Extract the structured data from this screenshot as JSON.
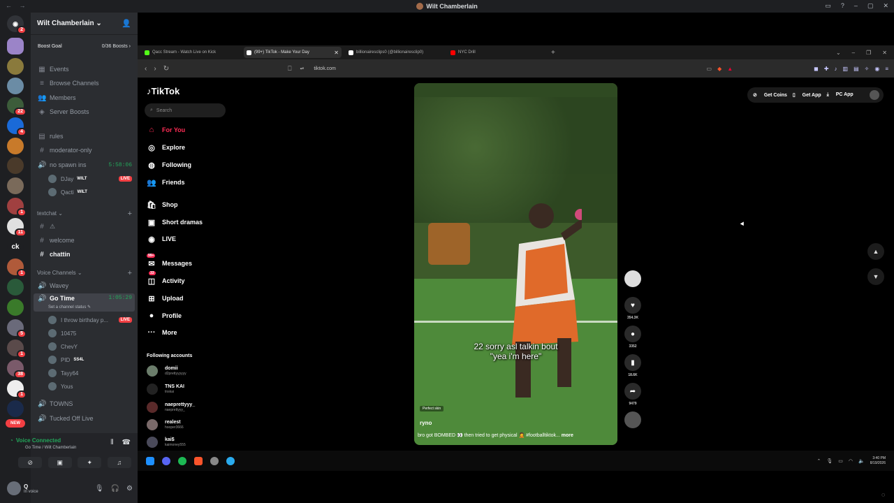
{
  "window": {
    "title": "Wilt Chamberlain"
  },
  "discord": {
    "server_name": "Wilt Chamberlain",
    "boost_goal_label": "Boost Goal",
    "boost_count": "0/36 Boosts",
    "channels": [
      {
        "name": "Events",
        "icon": "calendar-icon"
      },
      {
        "name": "Browse Channels",
        "icon": "list-icon"
      },
      {
        "name": "Members",
        "icon": "members-icon"
      },
      {
        "name": "Server Boosts",
        "icon": "boost-icon"
      },
      {
        "name": "rules",
        "icon": "rules-icon"
      },
      {
        "name": "moderator-only",
        "icon": "hash-icon"
      },
      {
        "name": "no spawn ins",
        "icon": "voice-icon",
        "timer": "5:58:06"
      }
    ],
    "no_spawn_users": [
      {
        "name": "DJay",
        "tag": "WILT"
      },
      {
        "name": "Qacti",
        "tag": "WILT"
      }
    ],
    "textchat_label": "textchat",
    "text_channels": [
      {
        "name": "⚠"
      },
      {
        "name": "welcome"
      },
      {
        "name": "chattin"
      }
    ],
    "voice_channels_label": "Voice Channels",
    "voice_channels": [
      {
        "name": "Wavey"
      },
      {
        "name": "Go Time",
        "timer": "1:05:29",
        "status": "Set a channel status"
      }
    ],
    "go_time_users": [
      {
        "name": "I throw birthday p...",
        "live": "LIVE"
      },
      {
        "name": "10475"
      },
      {
        "name": "ChevY"
      },
      {
        "name": "PID",
        "tag": "SS4L"
      },
      {
        "name": "Tayy64"
      },
      {
        "name": "Yous"
      }
    ],
    "more_voice": [
      {
        "name": "TOWNS"
      },
      {
        "name": "Tucked Off Live"
      }
    ],
    "live_label": "LIVE",
    "voice_status": {
      "title": "Voice Connected",
      "channel": "Go Time / Wilt Chamberlain"
    },
    "user": {
      "name": "Q",
      "status": "In voice"
    }
  },
  "guild_badges": [
    "2",
    "22",
    "4",
    "1",
    "11",
    "ck",
    "1",
    "5",
    "1",
    "38",
    "1",
    "NEW"
  ],
  "browser": {
    "tabs": [
      {
        "title": "Qacc Stream - Watch Live on Kick",
        "color": "#53fc18"
      },
      {
        "title": "(99+) TikTok - Make Your Day",
        "color": "#ffffff",
        "active": true
      },
      {
        "title": "billionairesclips0 (@billionairesclip0)",
        "color": "#ffffff"
      },
      {
        "title": "NYC Drill",
        "color": "#ff0000"
      }
    ],
    "url": "tiktok.com"
  },
  "tiktok": {
    "logo": "TikTok",
    "search_placeholder": "Search",
    "nav": [
      {
        "label": "For You",
        "icon": "home-icon",
        "active": true
      },
      {
        "label": "Explore",
        "icon": "compass-icon"
      },
      {
        "label": "Following",
        "icon": "following-icon"
      },
      {
        "label": "Friends",
        "icon": "friends-icon"
      },
      {
        "label": "Shop",
        "icon": "shop-icon"
      },
      {
        "label": "Short dramas",
        "icon": "drama-icon"
      },
      {
        "label": "LIVE",
        "icon": "live-icon"
      },
      {
        "label": "Messages",
        "icon": "messages-icon",
        "badge": "99+"
      },
      {
        "label": "Activity",
        "icon": "activity-icon",
        "badge": "33"
      },
      {
        "label": "Upload",
        "icon": "upload-icon"
      },
      {
        "label": "Profile",
        "icon": "profile-icon"
      },
      {
        "label": "More",
        "icon": "more-icon"
      }
    ],
    "following_accounts_label": "Following accounts",
    "following_accounts": [
      {
        "name": "domii",
        "handle": "d2prettyyyyyy"
      },
      {
        "name": "TNS KAI",
        "handle": "tnskai"
      },
      {
        "name": "naeprettyyy_",
        "handle": "naeprettyyy_"
      },
      {
        "name": "realest",
        "handle": "hooper3666"
      },
      {
        "name": "kai$",
        "handle": "kaimoney555"
      }
    ],
    "top_actions": [
      "Get Coins",
      "Get App",
      "PC App"
    ],
    "video": {
      "caption_line1": "22 sorry asl talkin bout",
      "caption_line2": "\"yea i'm here\"",
      "chip": "Perfect skin",
      "username": "ryno",
      "description": "bro got BOMBED 👀 then tried to get physical 🤦 #footballtiktok...",
      "more": "more"
    },
    "actions": [
      {
        "icon": "heart-icon",
        "count": "354.3K"
      },
      {
        "icon": "comment-icon",
        "count": "3352"
      },
      {
        "icon": "bookmark-icon",
        "count": "18.6K"
      },
      {
        "icon": "share-icon",
        "count": "9479"
      }
    ]
  },
  "taskbar": {
    "time": "3:40 PM",
    "date": "8/19/2026"
  }
}
